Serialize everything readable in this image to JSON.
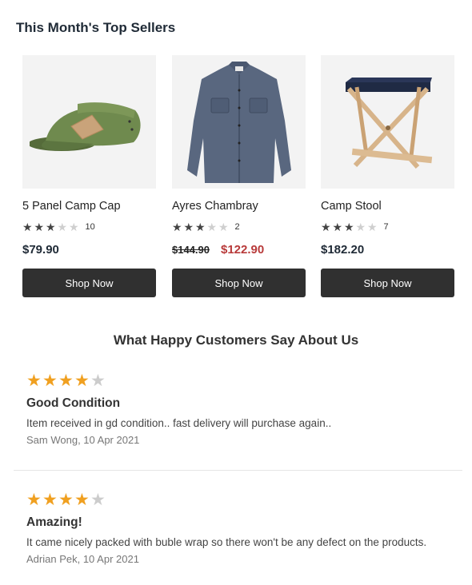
{
  "top_sellers": {
    "title": "This Month's Top Sellers",
    "products": [
      {
        "name": "5 Panel Camp Cap",
        "image_icon": "green-camp-cap",
        "rating": 3,
        "max_rating": 5,
        "review_count": "10",
        "price": "$79.90",
        "old_price": null,
        "sale_price": null,
        "button_label": "Shop Now"
      },
      {
        "name": "Ayres Chambray",
        "image_icon": "chambray-shirt",
        "rating": 3,
        "max_rating": 5,
        "review_count": "2",
        "price": null,
        "old_price": "$144.90",
        "sale_price": "$122.90",
        "button_label": "Shop Now"
      },
      {
        "name": "Camp Stool",
        "image_icon": "folding-camp-stool",
        "rating": 3,
        "max_rating": 5,
        "review_count": "7",
        "price": "$182.20",
        "old_price": null,
        "sale_price": null,
        "button_label": "Shop Now"
      }
    ]
  },
  "reviews": {
    "title": "What Happy Customers Say About Us",
    "items": [
      {
        "rating": 4,
        "max_rating": 5,
        "title": "Good Condition",
        "body": "Item received in gd condition.. fast delivery will purchase again..",
        "author_date": "Sam Wong, 10 Apr 2021"
      },
      {
        "rating": 4,
        "max_rating": 5,
        "title": "Amazing!",
        "body": "It came nicely packed with buble wrap so there won't be any defect on the products.",
        "author_date": "Adrian Pek, 10 Apr 2021"
      }
    ]
  },
  "colors": {
    "button_bg": "#303030",
    "sale_price": "#b83a3a",
    "review_star": "#f0a020",
    "product_star": "#444444",
    "empty_star": "#cfcfcf"
  }
}
